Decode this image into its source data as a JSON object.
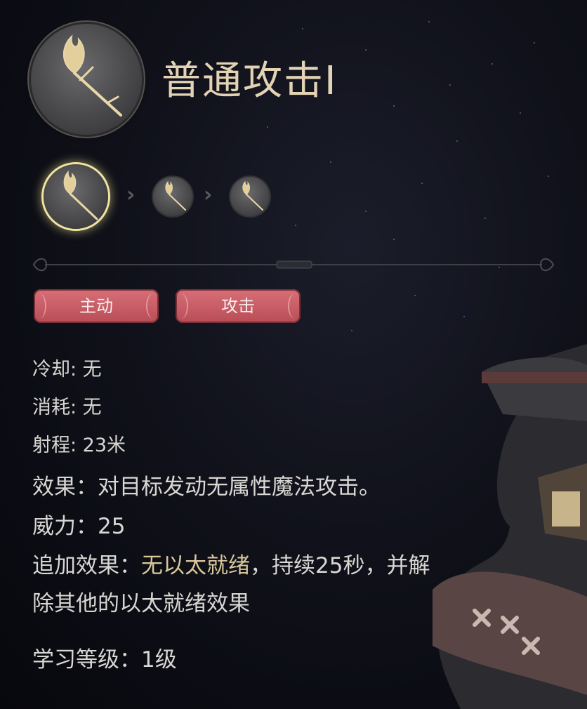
{
  "skill": {
    "title": "普通攻击Ⅰ",
    "icon": "staff-icon"
  },
  "upgrade_path": {
    "icons": [
      "staff-icon",
      "staff-icon",
      "staff-icon"
    ],
    "arrow_icon": "chevron-right-icon"
  },
  "tags": [
    "主动",
    "攻击"
  ],
  "stats": {
    "cooldown": "冷却: 无",
    "cost": "消耗: 无",
    "range": "射程: 23米"
  },
  "effect": {
    "main": "效果：对目标发动无属性魔法攻击。",
    "power": "威力：25",
    "extra_label": "追加效果：",
    "extra_highlight": "无以太就绪",
    "extra_rest_1": "，持续25秒，并解",
    "extra_rest_2": "除其他的以太就绪效果"
  },
  "learn_level": "学习等级：1级",
  "colors": {
    "title": "#e3d3b4",
    "highlight": "#d9c89b",
    "tag": "#c95c66",
    "active_ring": "#f1e4a2"
  }
}
